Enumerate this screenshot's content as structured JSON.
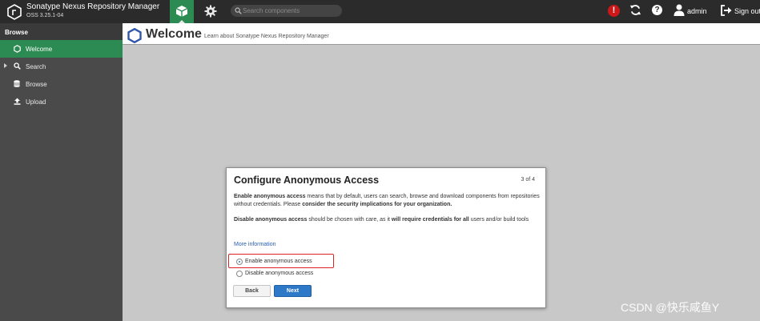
{
  "app": {
    "title": "Sonatype Nexus Repository Manager",
    "version": "OSS 3.25.1-04"
  },
  "topbar": {
    "search_placeholder": "Search components",
    "user": "admin",
    "signout": "Sign out",
    "alert_icon": "!",
    "help_icon": "?"
  },
  "sidebar": {
    "header": "Browse",
    "items": [
      {
        "label": "Welcome",
        "icon": "hexagon-icon"
      },
      {
        "label": "Search",
        "icon": "search-icon"
      },
      {
        "label": "Browse",
        "icon": "database-icon"
      },
      {
        "label": "Upload",
        "icon": "upload-icon"
      }
    ]
  },
  "page": {
    "title": "Welcome",
    "subtitle": "Learn about Sonatype Nexus Repository Manager"
  },
  "dialog": {
    "title": "Configure Anonymous Access",
    "step": "3 of 4",
    "p1_bold1": "Enable anonymous access",
    "p1_text": " means that by default, users can search, browse and download components from repositories without credentials. Please ",
    "p1_bold2": "consider the security implications for your organization.",
    "p2_bold1": "Disable anonymous access",
    "p2_text": " should be chosen with care, as it ",
    "p2_bold2": "will require credentials for all",
    "p2_text2": " users and/or build tools",
    "more_info": "More information",
    "option_enable": "Enable anonymous access",
    "option_disable": "Disable anonymous access",
    "back": "Back",
    "next": "Next"
  },
  "watermark": "CSDN @快乐咸鱼Y",
  "colors": {
    "topbar": "#2b2b2b",
    "sidebar": "#4a4a4a",
    "active_green": "#2c8b52",
    "primary_blue": "#2e78c8",
    "highlight_red": "#dd2222"
  }
}
